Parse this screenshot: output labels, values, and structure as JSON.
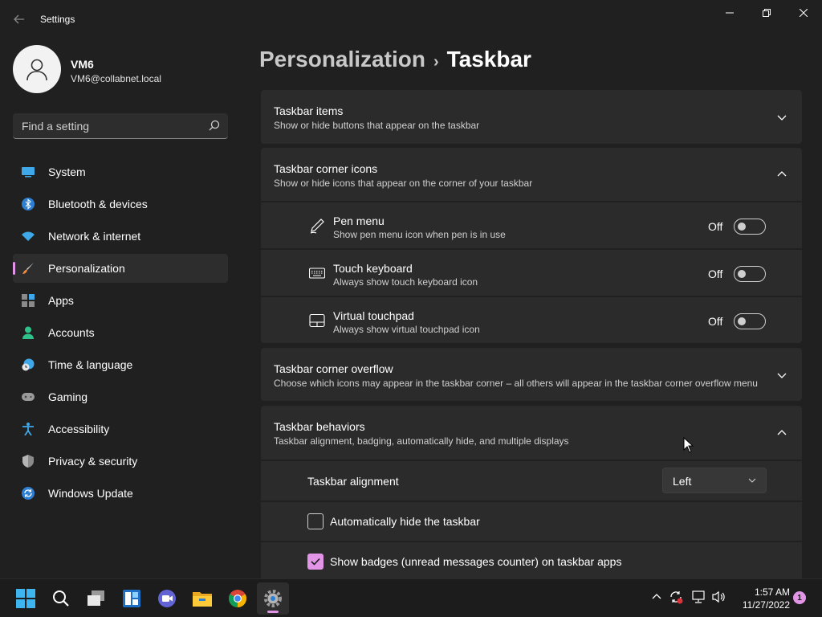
{
  "window": {
    "app_title": "Settings",
    "controls": {
      "minimize": "—",
      "maximize": "❐",
      "close": "✕"
    }
  },
  "profile": {
    "name": "VM6",
    "email": "VM6@collabnet.local"
  },
  "search": {
    "placeholder": "Find a setting",
    "icon": "search-icon"
  },
  "sidebar": {
    "items": [
      {
        "label": "System",
        "icon": "system-icon",
        "active": false
      },
      {
        "label": "Bluetooth & devices",
        "icon": "bluetooth-icon",
        "active": false
      },
      {
        "label": "Network & internet",
        "icon": "wifi-icon",
        "active": false
      },
      {
        "label": "Personalization",
        "icon": "brush-icon",
        "active": true
      },
      {
        "label": "Apps",
        "icon": "apps-icon",
        "active": false
      },
      {
        "label": "Accounts",
        "icon": "accounts-icon",
        "active": false
      },
      {
        "label": "Time & language",
        "icon": "clock-globe-icon",
        "active": false
      },
      {
        "label": "Gaming",
        "icon": "gamepad-icon",
        "active": false
      },
      {
        "label": "Accessibility",
        "icon": "accessibility-icon",
        "active": false
      },
      {
        "label": "Privacy & security",
        "icon": "shield-icon",
        "active": false
      },
      {
        "label": "Windows Update",
        "icon": "update-icon",
        "active": false
      }
    ]
  },
  "breadcrumb": {
    "parent": "Personalization",
    "separator": "›",
    "current": "Taskbar"
  },
  "sections": {
    "items": {
      "title": "Taskbar items",
      "desc": "Show or hide buttons that appear on the taskbar",
      "expanded": false
    },
    "corner_icons": {
      "title": "Taskbar corner icons",
      "desc": "Show or hide icons that appear on the corner of your taskbar",
      "expanded": true,
      "rows": [
        {
          "title": "Pen menu",
          "desc": "Show pen menu icon when pen is in use",
          "state": "Off",
          "icon": "pen-icon"
        },
        {
          "title": "Touch keyboard",
          "desc": "Always show touch keyboard icon",
          "state": "Off",
          "icon": "keyboard-icon"
        },
        {
          "title": "Virtual touchpad",
          "desc": "Always show virtual touchpad icon",
          "state": "Off",
          "icon": "touchpad-icon"
        }
      ]
    },
    "overflow": {
      "title": "Taskbar corner overflow",
      "desc": "Choose which icons may appear in the taskbar corner – all others will appear in the taskbar corner overflow menu",
      "expanded": false
    },
    "behaviors": {
      "title": "Taskbar behaviors",
      "desc": "Taskbar alignment, badging, automatically hide, and multiple displays",
      "expanded": true,
      "alignment": {
        "label": "Taskbar alignment",
        "value": "Left"
      },
      "auto_hide": {
        "label": "Automatically hide the taskbar",
        "checked": false
      },
      "badges": {
        "label": "Show badges (unread messages counter) on taskbar apps",
        "checked": true
      }
    }
  },
  "taskbar": {
    "apps": [
      "start-icon",
      "search-icon",
      "task-view-icon",
      "widgets-icon",
      "teams-chat-icon",
      "file-explorer-icon",
      "chrome-icon",
      "settings-icon"
    ],
    "active_app": "settings-icon",
    "clock": {
      "time": "1:57 AM",
      "date": "11/27/2022"
    },
    "notification_count": "1"
  },
  "colors": {
    "accent": "#e294e6",
    "background": "#202020",
    "card": "#2b2b2b"
  }
}
